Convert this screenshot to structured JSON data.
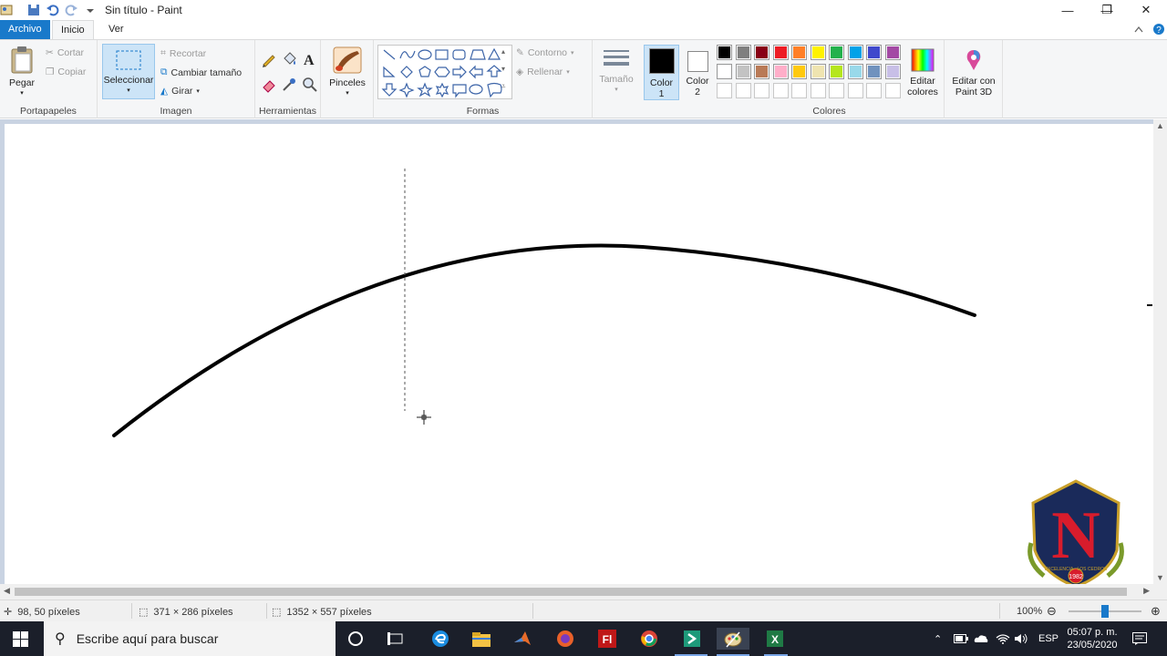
{
  "window": {
    "title": "Sin título - Paint",
    "minimize_glyph": "—",
    "restore_glyph": "❐",
    "close_glyph": "✕"
  },
  "tabs": [
    "Archivo",
    "Inicio",
    "Ver"
  ],
  "ribbon": {
    "clipboard": {
      "label": "Portapapeles",
      "paste": "Pegar",
      "cut": "Cortar",
      "copy": "Copiar"
    },
    "image": {
      "label": "Imagen",
      "select": "Seleccionar",
      "crop": "Recortar",
      "resize": "Cambiar tamaño",
      "rotate": "Girar"
    },
    "tools": {
      "label": "Herramientas"
    },
    "brushes": {
      "label": "Pinceles"
    },
    "shapes": {
      "label": "Formas",
      "outline": "Contorno",
      "fill": "Rellenar"
    },
    "size": {
      "label": "Tamaño"
    },
    "color1": {
      "label": "Color 1",
      "value": "#000000"
    },
    "color2": {
      "label": "Color 2",
      "value": "#ffffff"
    },
    "colors": {
      "label": "Colores",
      "row1": [
        "#000000",
        "#7f7f7f",
        "#880015",
        "#ed1c24",
        "#ff7f27",
        "#fff200",
        "#22b14c",
        "#00a2e8",
        "#3f48cc",
        "#a349a4"
      ],
      "row2": [
        "#ffffff",
        "#c3c3c3",
        "#b97a57",
        "#ffaec9",
        "#ffc90e",
        "#efe4b0",
        "#b5e61d",
        "#99d9ea",
        "#7092be",
        "#c8bfe7"
      ],
      "row3_count": 10
    },
    "edit_colors": "Editar colores",
    "paint3d": "Editar con Paint 3D"
  },
  "status": {
    "cursor_pos": "98, 50 píxeles",
    "selection_size": "371 × 286 píxeles",
    "image_size": "1352 × 557 píxeles",
    "zoom": "100%"
  },
  "taskbar": {
    "search_placeholder": "Escribe aquí para buscar",
    "language": "ESP",
    "time": "05:07 p. m.",
    "date": "23/05/2020"
  },
  "watermark": {
    "letter": "N",
    "motto": "EXCELENCIA · LOS CEDROS",
    "year": "1982"
  }
}
